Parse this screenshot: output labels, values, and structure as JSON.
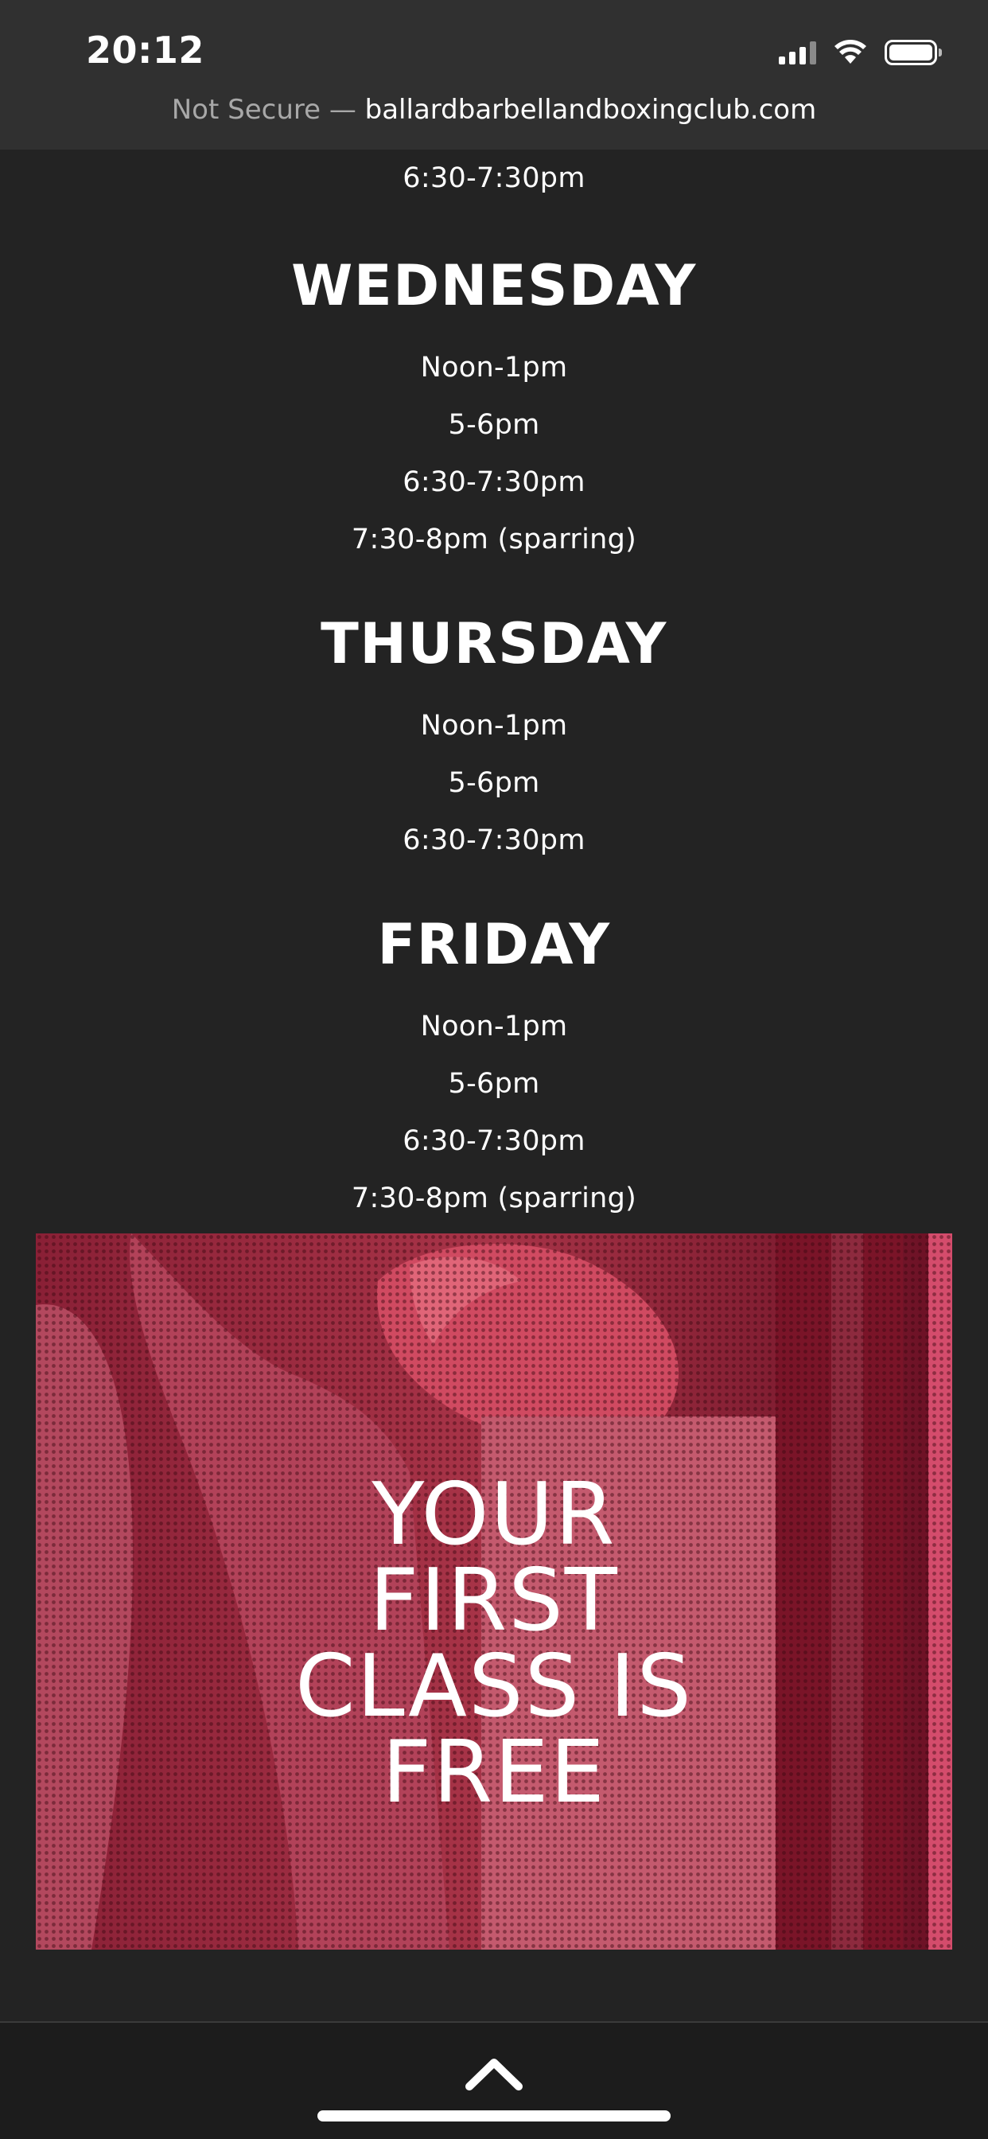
{
  "status_bar": {
    "time": "20:12",
    "icons": [
      "cellular-signal-icon",
      "wifi-icon",
      "battery-icon"
    ]
  },
  "url_bar": {
    "security_label": "Not Secure —",
    "domain": "ballardbarbellandboxingclub.com"
  },
  "schedule": {
    "top_partial_slot": "6:30-7:30pm",
    "days": [
      {
        "day": "WEDNESDAY",
        "slots": [
          "Noon-1pm",
          "5-6pm",
          "6:30-7:30pm",
          "7:30-8pm (sparring)"
        ]
      },
      {
        "day": "THURSDAY",
        "slots": [
          "Noon-1pm",
          "5-6pm",
          "6:30-7:30pm"
        ]
      },
      {
        "day": "FRIDAY",
        "slots": [
          "Noon-1pm",
          "5-6pm",
          "6:30-7:30pm",
          "7:30-8pm (sparring)"
        ]
      }
    ]
  },
  "promo": {
    "lines": [
      "YOUR",
      "FIRST",
      "CLASS IS",
      "FREE"
    ],
    "accent_color": "#c4324f"
  },
  "toolbar": {
    "scroll_top_icon": "chevron-up-icon"
  }
}
